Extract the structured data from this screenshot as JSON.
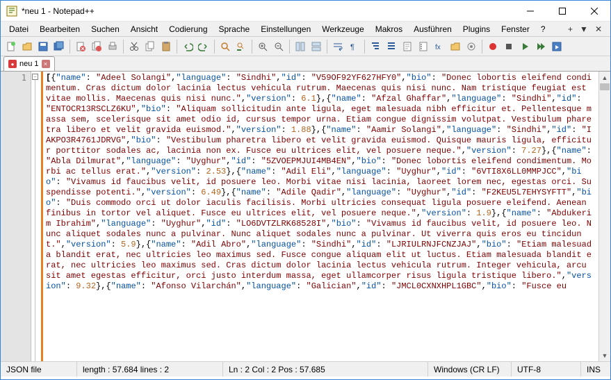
{
  "window": {
    "title": "*neu 1 - Notepad++"
  },
  "menu": {
    "items": [
      "Datei",
      "Bearbeiten",
      "Suchen",
      "Ansicht",
      "Codierung",
      "Sprache",
      "Einstellungen",
      "Werkzeuge",
      "Makros",
      "Ausführen",
      "Plugins",
      "Fenster",
      "?"
    ],
    "right": [
      "+",
      "▼",
      "✕"
    ]
  },
  "tabs": {
    "items": [
      {
        "label": "neu 1"
      }
    ]
  },
  "gutter": {
    "line1": "1"
  },
  "code": {
    "tokens": [
      {
        "t": "b",
        "v": "["
      },
      {
        "t": "p",
        "v": "{"
      },
      {
        "t": "k",
        "v": "\"name\""
      },
      {
        "t": "p",
        "v": ": "
      },
      {
        "t": "s",
        "v": "\"Adeel Solangi\""
      },
      {
        "t": "p",
        "v": ","
      },
      {
        "t": "k",
        "v": "\"language\""
      },
      {
        "t": "p",
        "v": ": "
      },
      {
        "t": "s",
        "v": "\"Sindhi\""
      },
      {
        "t": "p",
        "v": ","
      },
      {
        "t": "k",
        "v": "\"id\""
      },
      {
        "t": "p",
        "v": ": "
      },
      {
        "t": "s",
        "v": "\"V59OF92YF627HFY0\""
      },
      {
        "t": "p",
        "v": ","
      },
      {
        "t": "k",
        "v": "\"bio\""
      },
      {
        "t": "p",
        "v": ": "
      },
      {
        "t": "s",
        "v": "\"Donec lobortis eleifend condimentum. Cras dictum dolor lacinia lectus vehicula rutrum. Maecenas quis nisi nunc. Nam tristique feugiat est vitae mollis. Maecenas quis nisi nunc.\""
      },
      {
        "t": "p",
        "v": ","
      },
      {
        "t": "k",
        "v": "\"version\""
      },
      {
        "t": "p",
        "v": ": "
      },
      {
        "t": "n",
        "v": "6.1"
      },
      {
        "t": "p",
        "v": "},{"
      },
      {
        "t": "k",
        "v": "\"name\""
      },
      {
        "t": "p",
        "v": ": "
      },
      {
        "t": "s",
        "v": "\"Afzal Ghaffar\""
      },
      {
        "t": "p",
        "v": ","
      },
      {
        "t": "k",
        "v": "\"language\""
      },
      {
        "t": "p",
        "v": ": "
      },
      {
        "t": "s",
        "v": "\"Sindhi\""
      },
      {
        "t": "p",
        "v": ","
      },
      {
        "t": "k",
        "v": "\"id\""
      },
      {
        "t": "p",
        "v": ": "
      },
      {
        "t": "s",
        "v": "\"ENTOCR13RSCLZ6KU\""
      },
      {
        "t": "p",
        "v": ","
      },
      {
        "t": "k",
        "v": "\"bio\""
      },
      {
        "t": "p",
        "v": ": "
      },
      {
        "t": "s",
        "v": "\"Aliquam sollicitudin ante ligula, eget malesuada nibh efficitur et. Pellentesque massa sem, scelerisque sit amet odio id, cursus tempor urna. Etiam congue dignissim volutpat. Vestibulum pharetra libero et velit gravida euismod.\""
      },
      {
        "t": "p",
        "v": ","
      },
      {
        "t": "k",
        "v": "\"version\""
      },
      {
        "t": "p",
        "v": ": "
      },
      {
        "t": "n",
        "v": "1.88"
      },
      {
        "t": "p",
        "v": "},{"
      },
      {
        "t": "k",
        "v": "\"name\""
      },
      {
        "t": "p",
        "v": ": "
      },
      {
        "t": "s",
        "v": "\"Aamir Solangi\""
      },
      {
        "t": "p",
        "v": ","
      },
      {
        "t": "k",
        "v": "\"language\""
      },
      {
        "t": "p",
        "v": ": "
      },
      {
        "t": "s",
        "v": "\"Sindhi\""
      },
      {
        "t": "p",
        "v": ","
      },
      {
        "t": "k",
        "v": "\"id\""
      },
      {
        "t": "p",
        "v": ": "
      },
      {
        "t": "s",
        "v": "\"IAKPO3R4761JDRVG\""
      },
      {
        "t": "p",
        "v": ","
      },
      {
        "t": "k",
        "v": "\"bio\""
      },
      {
        "t": "p",
        "v": ": "
      },
      {
        "t": "s",
        "v": "\"Vestibulum pharetra libero et velit gravida euismod. Quisque mauris ligula, efficitur porttitor sodales ac, lacinia non ex. Fusce eu ultrices elit, vel posuere neque.\""
      },
      {
        "t": "p",
        "v": ","
      },
      {
        "t": "k",
        "v": "\"version\""
      },
      {
        "t": "p",
        "v": ": "
      },
      {
        "t": "n",
        "v": "7.27"
      },
      {
        "t": "p",
        "v": "},{"
      },
      {
        "t": "k",
        "v": "\"name\""
      },
      {
        "t": "p",
        "v": ": "
      },
      {
        "t": "s",
        "v": "\"Abla Dilmurat\""
      },
      {
        "t": "p",
        "v": ","
      },
      {
        "t": "k",
        "v": "\"language\""
      },
      {
        "t": "p",
        "v": ": "
      },
      {
        "t": "s",
        "v": "\"Uyghur\""
      },
      {
        "t": "p",
        "v": ","
      },
      {
        "t": "k",
        "v": "\"id\""
      },
      {
        "t": "p",
        "v": ": "
      },
      {
        "t": "s",
        "v": "\"5ZVOEPMJUI4MB4EN\""
      },
      {
        "t": "p",
        "v": ","
      },
      {
        "t": "k",
        "v": "\"bio\""
      },
      {
        "t": "p",
        "v": ": "
      },
      {
        "t": "s",
        "v": "\"Donec lobortis eleifend condimentum. Morbi ac tellus erat.\""
      },
      {
        "t": "p",
        "v": ","
      },
      {
        "t": "k",
        "v": "\"version\""
      },
      {
        "t": "p",
        "v": ": "
      },
      {
        "t": "n",
        "v": "2.53"
      },
      {
        "t": "p",
        "v": "},{"
      },
      {
        "t": "k",
        "v": "\"name\""
      },
      {
        "t": "p",
        "v": ": "
      },
      {
        "t": "s",
        "v": "\"Adil Eli\""
      },
      {
        "t": "p",
        "v": ","
      },
      {
        "t": "k",
        "v": "\"language\""
      },
      {
        "t": "p",
        "v": ": "
      },
      {
        "t": "s",
        "v": "\"Uyghur\""
      },
      {
        "t": "p",
        "v": ","
      },
      {
        "t": "k",
        "v": "\"id\""
      },
      {
        "t": "p",
        "v": ": "
      },
      {
        "t": "s",
        "v": "\"6VTI8X6LL0MMPJCC\""
      },
      {
        "t": "p",
        "v": ","
      },
      {
        "t": "k",
        "v": "\"bio\""
      },
      {
        "t": "p",
        "v": ": "
      },
      {
        "t": "s",
        "v": "\"Vivamus id faucibus velit, id posuere leo. Morbi vitae nisi lacinia, laoreet lorem nec, egestas orci. Suspendisse potenti.\""
      },
      {
        "t": "p",
        "v": ","
      },
      {
        "t": "k",
        "v": "\"version\""
      },
      {
        "t": "p",
        "v": ": "
      },
      {
        "t": "n",
        "v": "6.49"
      },
      {
        "t": "p",
        "v": "},{"
      },
      {
        "t": "k",
        "v": "\"name\""
      },
      {
        "t": "p",
        "v": ": "
      },
      {
        "t": "s",
        "v": "\"Adile Qadir\""
      },
      {
        "t": "p",
        "v": ","
      },
      {
        "t": "k",
        "v": "\"language\""
      },
      {
        "t": "p",
        "v": ": "
      },
      {
        "t": "s",
        "v": "\"Uyghur\""
      },
      {
        "t": "p",
        "v": ","
      },
      {
        "t": "k",
        "v": "\"id\""
      },
      {
        "t": "p",
        "v": ": "
      },
      {
        "t": "s",
        "v": "\"F2KEU5L7EHYSYFTT\""
      },
      {
        "t": "p",
        "v": ","
      },
      {
        "t": "k",
        "v": "\"bio\""
      },
      {
        "t": "p",
        "v": ": "
      },
      {
        "t": "s",
        "v": "\"Duis commodo orci ut dolor iaculis facilisis. Morbi ultricies consequat ligula posuere eleifend. Aenean finibus in tortor vel aliquet. Fusce eu ultrices elit, vel posuere neque.\""
      },
      {
        "t": "p",
        "v": ","
      },
      {
        "t": "k",
        "v": "\"version\""
      },
      {
        "t": "p",
        "v": ": "
      },
      {
        "t": "n",
        "v": "1.9"
      },
      {
        "t": "p",
        "v": "},{"
      },
      {
        "t": "k",
        "v": "\"name\""
      },
      {
        "t": "p",
        "v": ": "
      },
      {
        "t": "s",
        "v": "\"Abdukerim Ibrahim\""
      },
      {
        "t": "p",
        "v": ","
      },
      {
        "t": "k",
        "v": "\"language\""
      },
      {
        "t": "p",
        "v": ": "
      },
      {
        "t": "s",
        "v": "\"Uyghur\""
      },
      {
        "t": "p",
        "v": ","
      },
      {
        "t": "k",
        "v": "\"id\""
      },
      {
        "t": "p",
        "v": ": "
      },
      {
        "t": "s",
        "v": "\"LO6DVTZLRK68528I\""
      },
      {
        "t": "p",
        "v": ","
      },
      {
        "t": "k",
        "v": "\"bio\""
      },
      {
        "t": "p",
        "v": ": "
      },
      {
        "t": "s",
        "v": "\"Vivamus id faucibus velit, id posuere leo. Nunc aliquet sodales nunc a pulvinar. Nunc aliquet sodales nunc a pulvinar. Ut viverra quis eros eu tincidunt.\""
      },
      {
        "t": "p",
        "v": ","
      },
      {
        "t": "k",
        "v": "\"version\""
      },
      {
        "t": "p",
        "v": ": "
      },
      {
        "t": "n",
        "v": "5.9"
      },
      {
        "t": "p",
        "v": "},{"
      },
      {
        "t": "k",
        "v": "\"name\""
      },
      {
        "t": "p",
        "v": ": "
      },
      {
        "t": "s",
        "v": "\"Adil Abro\""
      },
      {
        "t": "p",
        "v": ","
      },
      {
        "t": "k",
        "v": "\"language\""
      },
      {
        "t": "p",
        "v": ": "
      },
      {
        "t": "s",
        "v": "\"Sindhi\""
      },
      {
        "t": "p",
        "v": ","
      },
      {
        "t": "k",
        "v": "\"id\""
      },
      {
        "t": "p",
        "v": ": "
      },
      {
        "t": "s",
        "v": "\"LJRIULRNJFCNZJAJ\""
      },
      {
        "t": "p",
        "v": ","
      },
      {
        "t": "k",
        "v": "\"bio\""
      },
      {
        "t": "p",
        "v": ": "
      },
      {
        "t": "s",
        "v": "\"Etiam malesuada blandit erat, nec ultricies leo maximus sed. Fusce congue aliquam elit ut luctus. Etiam malesuada blandit erat, nec ultricies leo maximus sed. Cras dictum dolor lacinia lectus vehicula rutrum. Integer vehicula, arcu sit amet egestas efficitur, orci justo interdum massa, eget ullamcorper risus ligula tristique libero.\""
      },
      {
        "t": "p",
        "v": ","
      },
      {
        "t": "k",
        "v": "\"version\""
      },
      {
        "t": "p",
        "v": ": "
      },
      {
        "t": "n",
        "v": "9.32"
      },
      {
        "t": "p",
        "v": "},{"
      },
      {
        "t": "k",
        "v": "\"name\""
      },
      {
        "t": "p",
        "v": ": "
      },
      {
        "t": "s",
        "v": "\"Afonso Vilarchán\""
      },
      {
        "t": "p",
        "v": ","
      },
      {
        "t": "k",
        "v": "\"language\""
      },
      {
        "t": "p",
        "v": ": "
      },
      {
        "t": "s",
        "v": "\"Galician\""
      },
      {
        "t": "p",
        "v": ","
      },
      {
        "t": "k",
        "v": "\"id\""
      },
      {
        "t": "p",
        "v": ": "
      },
      {
        "t": "s",
        "v": "\"JMCL0CXNXHPL1GBC\""
      },
      {
        "t": "p",
        "v": ","
      },
      {
        "t": "k",
        "v": "\"bio\""
      },
      {
        "t": "p",
        "v": ": "
      },
      {
        "t": "s",
        "v": "\"Fusce eu"
      }
    ]
  },
  "status": {
    "filetype": "JSON file",
    "length": "length : 57.684    lines : 2",
    "pos": "Ln : 2    Col : 2    Pos : 57.685",
    "eol": "Windows (CR LF)",
    "enc": "UTF-8",
    "ins": "INS"
  }
}
